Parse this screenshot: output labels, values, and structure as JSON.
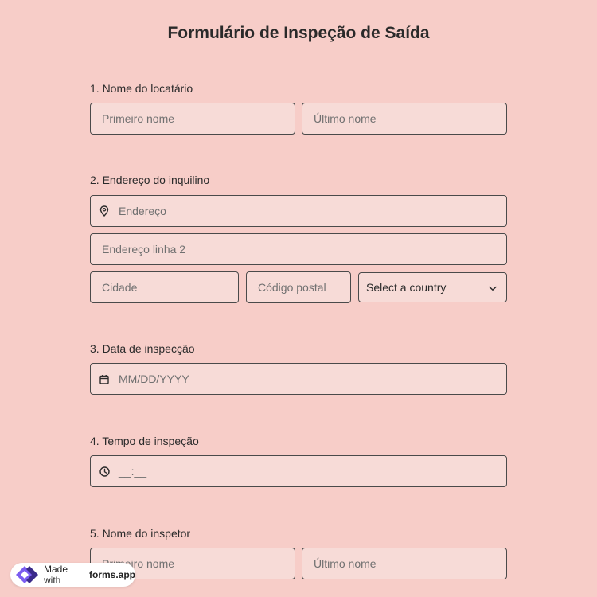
{
  "form": {
    "title": "Formulário de Inspeção de Saída",
    "q1": {
      "label": "1.  Nome do locatário",
      "first_placeholder": "Primeiro nome",
      "last_placeholder": "Último nome"
    },
    "q2": {
      "label": "2. Endereço do inquilino",
      "address_placeholder": "Endereço",
      "address2_placeholder": "Endereço linha 2",
      "city_placeholder": "Cidade",
      "postal_placeholder": "Código postal",
      "country_selected": "Select a country"
    },
    "q3": {
      "label": "3. Data de inspecção",
      "date_placeholder": "MM/DD/YYYY"
    },
    "q4": {
      "label": "4. Tempo de inspeção",
      "time_placeholder": "__:__"
    },
    "q5": {
      "label": "5. Nome do inspetor",
      "first_placeholder": "Primeiro nome",
      "last_placeholder": "Último nome"
    }
  },
  "badge": {
    "prefix": "Made with",
    "brand": "forms.app"
  },
  "icons": {
    "address": "location-pin-icon",
    "date": "calendar-icon",
    "time": "clock-icon",
    "select": "chevron-down-icon",
    "brand": "forms-app-logo-icon"
  },
  "colors": {
    "background": "#f7cdc8",
    "field_background": "#f7dbd7",
    "field_border": "#4a4a4a",
    "logo_purple": "#7b5cf0"
  }
}
